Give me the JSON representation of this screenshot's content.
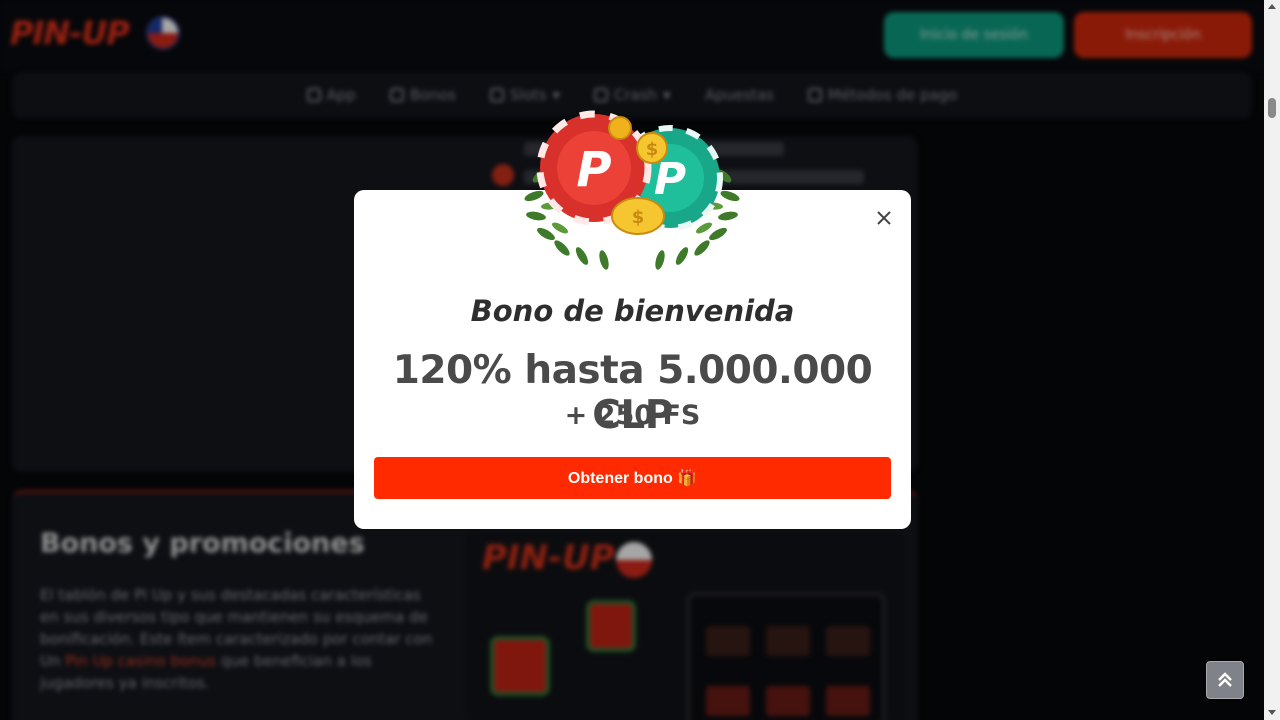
{
  "header": {
    "logo_text": "PIN-UP",
    "login_label": "Inicio de sesión",
    "register_label": "Inscripción"
  },
  "nav": {
    "items": [
      {
        "label": "App",
        "icon": "phone-icon"
      },
      {
        "label": "Bonos",
        "icon": "gift-icon"
      },
      {
        "label": "Slots",
        "icon": "slots-icon"
      },
      {
        "label": "Crash",
        "icon": "rocket-icon"
      },
      {
        "label": "Apuestas",
        "icon": ""
      },
      {
        "label": "Métodos de pago",
        "icon": "card-icon"
      }
    ]
  },
  "promo": {
    "title": "Bonos y promociones",
    "text_before_link": "El tablón de Pi Up y sus destacadas características en sus diversos tipo que mantienen su esquema de bonificación. Este ítem caracterizado por contar con Un",
    "link_text": "Pin Up casino bonus",
    "text_after_link": "que benefician a los jugadores ya inscritos.",
    "image_logo": "PIN-UP"
  },
  "modal": {
    "title": "Bono de bienvenida",
    "amount": "120% hasta 5.000.000 CLP",
    "free_spins": "+ 250 FS",
    "button_label": "Obtener bono 🎁",
    "close_icon": "close-icon"
  },
  "colors": {
    "login_green": "#0d9f82",
    "register_red": "#d5290d",
    "bonus_button": "#ff2a00",
    "modal_bg": "#ffffff"
  }
}
